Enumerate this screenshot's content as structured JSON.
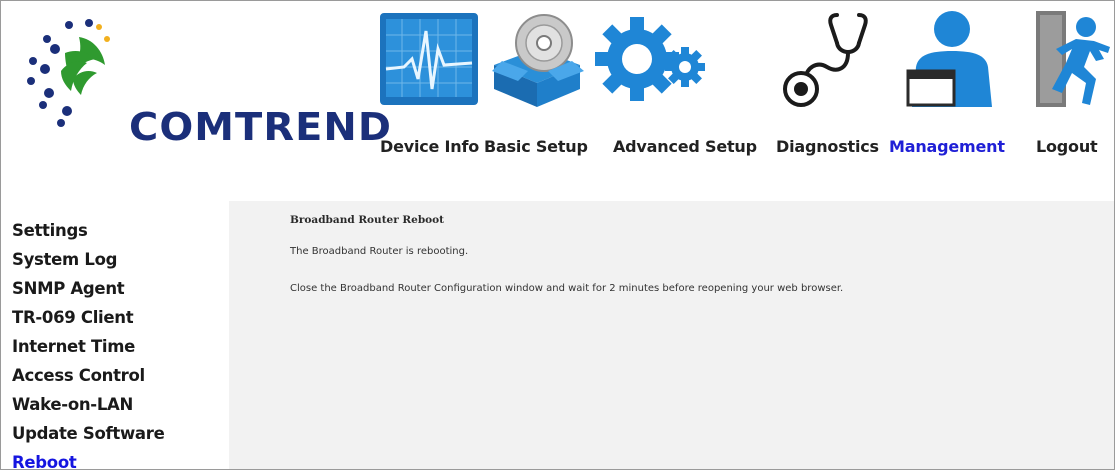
{
  "brand": {
    "name": "COMTREND",
    "color": "#1b2f7a"
  },
  "nav": {
    "items": [
      {
        "label": "Device Info",
        "icon": "device-info-monitor-icon"
      },
      {
        "label": "Basic Setup",
        "icon": "basic-setup-box-disc-icon"
      },
      {
        "label": "Advanced Setup",
        "icon": "advanced-setup-gears-icon"
      },
      {
        "label": "Diagnostics",
        "icon": "diagnostics-stethoscope-icon"
      },
      {
        "label": "Management",
        "icon": "management-person-icon",
        "active": true
      },
      {
        "label": "Logout",
        "icon": "logout-running-man-icon"
      }
    ],
    "active_color": "#1f1fd6"
  },
  "sidebar": {
    "items": [
      {
        "label": "Settings"
      },
      {
        "label": "System Log"
      },
      {
        "label": "SNMP Agent"
      },
      {
        "label": "TR-069 Client"
      },
      {
        "label": "Internet Time"
      },
      {
        "label": "Access Control"
      },
      {
        "label": "Wake-on-LAN"
      },
      {
        "label": "Update Software"
      },
      {
        "label": "Reboot",
        "active": true
      }
    ]
  },
  "content": {
    "title": "Broadband Router Reboot",
    "line1": "The Broadband Router is rebooting.",
    "line2": "Close the Broadband Router Configuration window and wait for 2 minutes before reopening your web browser."
  }
}
